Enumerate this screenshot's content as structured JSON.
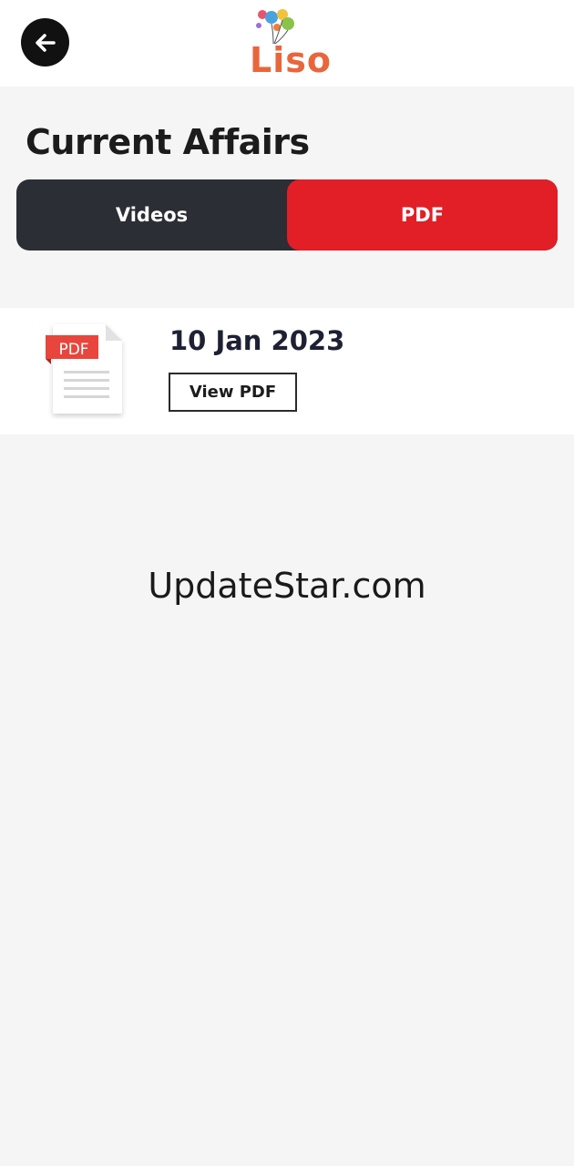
{
  "header": {
    "back_icon": "arrow-left-icon",
    "logo_text": "Liso"
  },
  "page": {
    "title": "Current Affairs"
  },
  "tabs": [
    {
      "label": "Videos",
      "selected": false
    },
    {
      "label": "PDF",
      "selected": true
    }
  ],
  "pdf_list": [
    {
      "icon_label": "PDF",
      "date": "10 Jan 2023",
      "button_label": "View PDF"
    }
  ],
  "watermark": "UpdateStar.com",
  "colors": {
    "accent_red": "#e21e26",
    "tab_dark": "#2b2e34",
    "logo_orange": "#e9663b",
    "background": "#f5f5f5"
  }
}
